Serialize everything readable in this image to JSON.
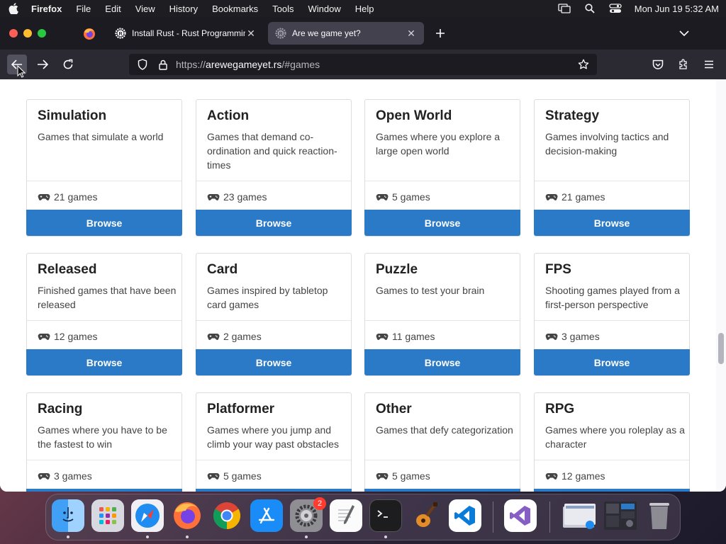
{
  "menubar": {
    "app_name": "Firefox",
    "items": [
      "File",
      "Edit",
      "View",
      "History",
      "Bookmarks",
      "Tools",
      "Window",
      "Help"
    ],
    "clock": "Mon Jun 19  5:32 AM"
  },
  "tabs": [
    {
      "title": "Install Rust - Rust Programming",
      "favicon": "rust-icon",
      "active": false
    },
    {
      "title": "Are we game yet?",
      "favicon": "rust-icon",
      "active": true
    }
  ],
  "urlbar": {
    "url_prefix": "https://",
    "url_domain": "arewegameyet.rs",
    "url_path": "/#games"
  },
  "colors": {
    "browse_button": "#2a7ac8",
    "tab_bar": "#1c1b22",
    "nav_bar": "#2b2a33"
  },
  "browse_label": "Browse",
  "cards": [
    {
      "name": "Simulation",
      "description": "Games that simulate a world",
      "count": "21 games"
    },
    {
      "name": "Action",
      "description": "Games that demand co-ordination and quick reaction-times",
      "count": "23 games"
    },
    {
      "name": "Open World",
      "description": "Games where you explore a large open world",
      "count": "5 games"
    },
    {
      "name": "Strategy",
      "description": "Games involving tactics and decision-making",
      "count": "21 games"
    },
    {
      "name": "Released",
      "description": "Finished games that have been released",
      "count": "12 games"
    },
    {
      "name": "Card",
      "description": "Games inspired by tabletop card games",
      "count": "2 games"
    },
    {
      "name": "Puzzle",
      "description": "Games to test your brain",
      "count": "11 games"
    },
    {
      "name": "FPS",
      "description": "Shooting games played from a first-person perspective",
      "count": "3 games"
    },
    {
      "name": "Racing",
      "description": "Games where you have to be the fastest to win",
      "count": "3 games"
    },
    {
      "name": "Platformer",
      "description": "Games where you jump and climb your way past obstacles",
      "count": "5 games"
    },
    {
      "name": "Other",
      "description": "Games that defy categorization",
      "count": "5 games"
    },
    {
      "name": "RPG",
      "description": "Games where you roleplay as a character",
      "count": "12 games"
    }
  ],
  "dock": {
    "apps": [
      "finder",
      "launchpad",
      "safari",
      "firefox",
      "chrome",
      "app-store",
      "system-settings",
      "textedit",
      "terminal",
      "garageband",
      "vscode",
      "visual-studio",
      "downloads-stack",
      "screenshots-stack",
      "trash"
    ],
    "system_settings_badge": "2"
  }
}
